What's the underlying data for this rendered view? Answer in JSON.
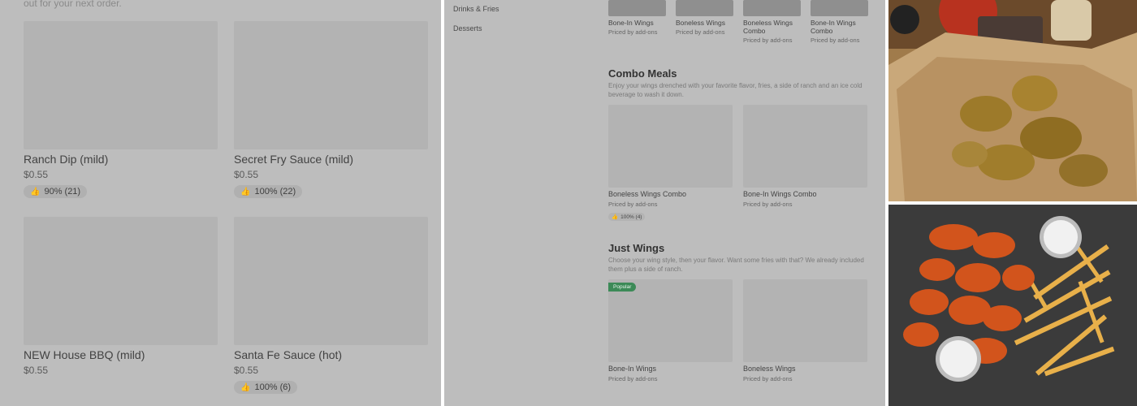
{
  "panel1": {
    "subtitle": "out for your next order.",
    "items": [
      {
        "title": "Ranch Dip (mild)",
        "price": "$0.55",
        "rating": "90% (21)"
      },
      {
        "title": "Secret Fry Sauce (mild)",
        "price": "$0.55",
        "rating": "100% (22)"
      },
      {
        "title": "NEW House BBQ (mild)",
        "price": "$0.55",
        "rating": ""
      },
      {
        "title": "Santa Fe Sauce (hot)",
        "price": "$0.55",
        "rating": "100% (6)"
      }
    ]
  },
  "panel2": {
    "nav": [
      "Drinks & Fries",
      "Desserts"
    ],
    "top_items": [
      {
        "title": "Bone-In Wings",
        "price": "Priced by add-ons"
      },
      {
        "title": "Boneless Wings",
        "price": "Priced by add-ons"
      },
      {
        "title": "Boneless Wings Combo",
        "price": "Priced by add-ons"
      },
      {
        "title": "Bone-In Wings Combo",
        "price": "Priced by add-ons"
      }
    ],
    "combo": {
      "title": "Combo Meals",
      "description": "Enjoy your wings drenched with your favorite flavor, fries, a side of ranch and an ice cold beverage to wash it down.",
      "items": [
        {
          "title": "Boneless Wings Combo",
          "price": "Priced by add-ons",
          "rating": "100% (4)"
        },
        {
          "title": "Bone-In Wings Combo",
          "price": "Priced by add-ons"
        }
      ]
    },
    "wings": {
      "title": "Just Wings",
      "description": "Choose your wing style, then your flavor. Want some fries with that? We already included them plus a side of ranch.",
      "badge": "Popular",
      "items": [
        {
          "title": "Bone-In Wings",
          "price": "Priced by add-ons"
        },
        {
          "title": "Boneless Wings",
          "price": "Priced by add-ons"
        }
      ]
    }
  },
  "icons": {
    "thumb": "thumbs-up-icon"
  }
}
